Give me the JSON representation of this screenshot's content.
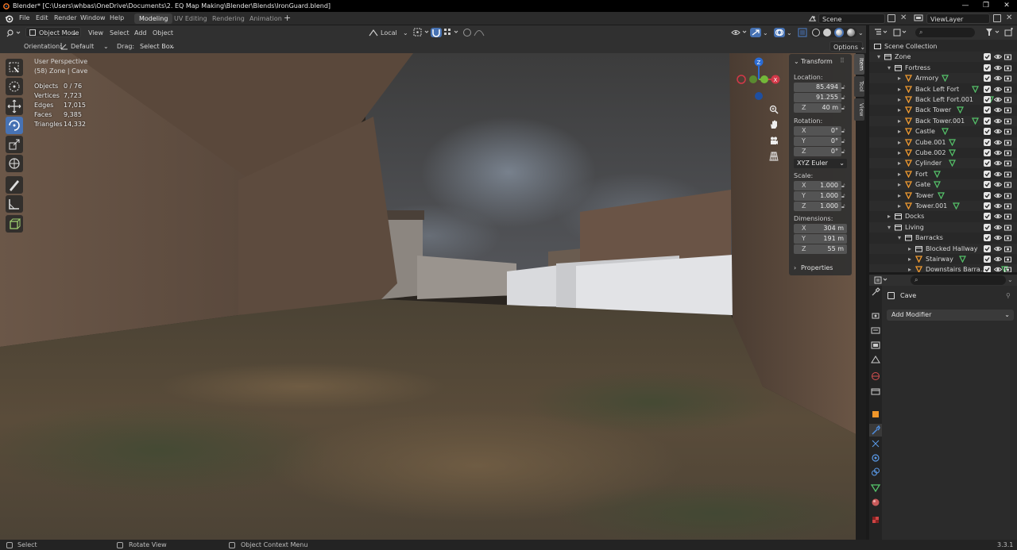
{
  "titlebar": {
    "text": "Blender* [C:\\Users\\whbas\\OneDrive\\Documents\\2. EQ Map Making\\Blender\\Blends\\IronGuard.blend]"
  },
  "menu": {
    "file": "File",
    "edit": "Edit",
    "render": "Render",
    "window": "Window",
    "help": "Help"
  },
  "workspaces": [
    "Modeling",
    "UV Editing",
    "Rendering",
    "Animation"
  ],
  "scene": {
    "label": "Scene",
    "view_layer": "ViewLayer"
  },
  "header": {
    "mode": "Object Mode",
    "view": "View",
    "select": "Select",
    "add": "Add",
    "object": "Object",
    "transform_space": "Local"
  },
  "toolsettings": {
    "orientation_label": "Orientation:",
    "orientation_value": "Default",
    "drag_label": "Drag:",
    "drag_value": "Select Box",
    "options": "Options"
  },
  "viewport": {
    "view_name": "User Perspective",
    "context": "(58) Zone | Cave",
    "stats": [
      {
        "label": "Objects",
        "value": "0 / 76"
      },
      {
        "label": "Vertices",
        "value": "7,723"
      },
      {
        "label": "Edges",
        "value": "17,015"
      },
      {
        "label": "Faces",
        "value": "9,385"
      },
      {
        "label": "Triangles",
        "value": "14,332"
      }
    ]
  },
  "npanel": {
    "title": "Transform",
    "location_label": "Location:",
    "location": [
      {
        "axis": "",
        "value": "85.494"
      },
      {
        "axis": "",
        "value": "91.255"
      },
      {
        "axis": "Z",
        "value": "40 m"
      }
    ],
    "rotation_label": "Rotation:",
    "rotation": [
      {
        "axis": "X",
        "value": "0°"
      },
      {
        "axis": "Y",
        "value": "0°"
      },
      {
        "axis": "Z",
        "value": "0°"
      }
    ],
    "rotation_mode": "XYZ Euler",
    "scale_label": "Scale:",
    "scale": [
      {
        "axis": "X",
        "value": "1.000"
      },
      {
        "axis": "Y",
        "value": "1.000"
      },
      {
        "axis": "Z",
        "value": "1.000"
      }
    ],
    "dimensions_label": "Dimensions:",
    "dimensions": [
      {
        "axis": "X",
        "value": "304 m"
      },
      {
        "axis": "Y",
        "value": "191 m"
      },
      {
        "axis": "Z",
        "value": "55 m"
      }
    ],
    "properties": "Properties",
    "tabs": [
      "Item",
      "Tool",
      "View"
    ]
  },
  "outliner": {
    "rows": [
      {
        "name": "Scene Collection",
        "level": 0,
        "type": "scene",
        "checks": false
      },
      {
        "name": "Zone",
        "level": 1,
        "type": "collection",
        "checks": true,
        "expanded": true
      },
      {
        "name": "Fortress",
        "level": 2,
        "type": "collection",
        "checks": true,
        "expanded": true
      },
      {
        "name": "Armory",
        "level": 3,
        "type": "mesh",
        "checks": true
      },
      {
        "name": "Back Left Fort",
        "level": 3,
        "type": "mesh",
        "checks": true
      },
      {
        "name": "Back Left Fort.001",
        "level": 3,
        "type": "mesh",
        "checks": true
      },
      {
        "name": "Back Tower",
        "level": 3,
        "type": "mesh",
        "checks": true
      },
      {
        "name": "Back Tower.001",
        "level": 3,
        "type": "mesh",
        "checks": true
      },
      {
        "name": "Castle",
        "level": 3,
        "type": "mesh",
        "checks": true
      },
      {
        "name": "Cube.001",
        "level": 3,
        "type": "mesh",
        "checks": true
      },
      {
        "name": "Cube.002",
        "level": 3,
        "type": "mesh",
        "checks": true
      },
      {
        "name": "Cylinder",
        "level": 3,
        "type": "mesh",
        "checks": true
      },
      {
        "name": "Fort",
        "level": 3,
        "type": "mesh",
        "checks": true
      },
      {
        "name": "Gate",
        "level": 3,
        "type": "mesh",
        "checks": true
      },
      {
        "name": "Tower",
        "level": 3,
        "type": "mesh",
        "checks": true
      },
      {
        "name": "Tower.001",
        "level": 3,
        "type": "mesh",
        "checks": true
      },
      {
        "name": "Docks",
        "level": 2,
        "type": "collection",
        "checks": true
      },
      {
        "name": "Living",
        "level": 2,
        "type": "collection",
        "checks": true,
        "expanded": true
      },
      {
        "name": "Barracks",
        "level": 3,
        "type": "collection",
        "checks": true,
        "expanded": true
      },
      {
        "name": "Blocked Hallway",
        "level": 4,
        "type": "collection",
        "checks": true
      },
      {
        "name": "Stairway",
        "level": 4,
        "type": "mesh",
        "checks": true
      },
      {
        "name": "Downstairs Barra...",
        "level": 4,
        "type": "mesh",
        "checks": true
      }
    ]
  },
  "properties": {
    "object_name": "Cave",
    "add_modifier": "Add Modifier"
  },
  "statusbar": {
    "select": "Select",
    "rotate": "Rotate View",
    "context": "Object Context Menu",
    "version": "3.3.1"
  }
}
